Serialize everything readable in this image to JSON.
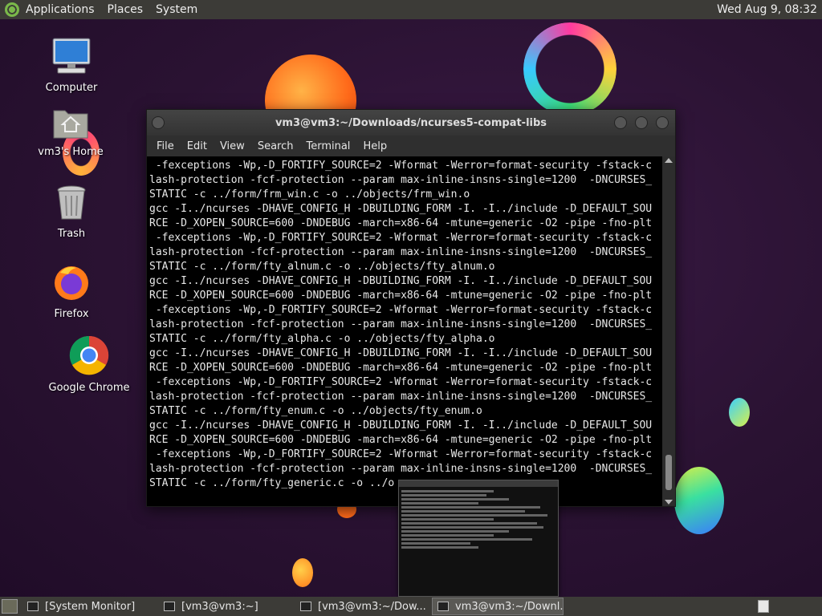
{
  "top_panel": {
    "menus": [
      "Applications",
      "Places",
      "System"
    ],
    "clock": "Wed Aug  9, 08:32"
  },
  "desktop_icons": {
    "computer": "Computer",
    "home": "vm3's Home",
    "trash": "Trash",
    "firefox": "Firefox",
    "chrome": "Google Chrome"
  },
  "terminal": {
    "title": "vm3@vm3:~/Downloads/ncurses5-compat-libs",
    "menus": [
      "File",
      "Edit",
      "View",
      "Search",
      "Terminal",
      "Help"
    ],
    "lines": [
      " -fexceptions -Wp,-D_FORTIFY_SOURCE=2 -Wformat -Werror=format-security -fstack-c",
      "lash-protection -fcf-protection --param max-inline-insns-single=1200  -DNCURSES_",
      "STATIC -c ../form/frm_win.c -o ../objects/frm_win.o",
      "gcc -I../ncurses -DHAVE_CONFIG_H -DBUILDING_FORM -I. -I../include -D_DEFAULT_SOU",
      "RCE -D_XOPEN_SOURCE=600 -DNDEBUG -march=x86-64 -mtune=generic -O2 -pipe -fno-plt",
      " -fexceptions -Wp,-D_FORTIFY_SOURCE=2 -Wformat -Werror=format-security -fstack-c",
      "lash-protection -fcf-protection --param max-inline-insns-single=1200  -DNCURSES_",
      "STATIC -c ../form/fty_alnum.c -o ../objects/fty_alnum.o",
      "gcc -I../ncurses -DHAVE_CONFIG_H -DBUILDING_FORM -I. -I../include -D_DEFAULT_SOU",
      "RCE -D_XOPEN_SOURCE=600 -DNDEBUG -march=x86-64 -mtune=generic -O2 -pipe -fno-plt",
      " -fexceptions -Wp,-D_FORTIFY_SOURCE=2 -Wformat -Werror=format-security -fstack-c",
      "lash-protection -fcf-protection --param max-inline-insns-single=1200  -DNCURSES_",
      "STATIC -c ../form/fty_alpha.c -o ../objects/fty_alpha.o",
      "gcc -I../ncurses -DHAVE_CONFIG_H -DBUILDING_FORM -I. -I../include -D_DEFAULT_SOU",
      "RCE -D_XOPEN_SOURCE=600 -DNDEBUG -march=x86-64 -mtune=generic -O2 -pipe -fno-plt",
      " -fexceptions -Wp,-D_FORTIFY_SOURCE=2 -Wformat -Werror=format-security -fstack-c",
      "lash-protection -fcf-protection --param max-inline-insns-single=1200  -DNCURSES_",
      "STATIC -c ../form/fty_enum.c -o ../objects/fty_enum.o",
      "gcc -I../ncurses -DHAVE_CONFIG_H -DBUILDING_FORM -I. -I../include -D_DEFAULT_SOU",
      "RCE -D_XOPEN_SOURCE=600 -DNDEBUG -march=x86-64 -mtune=generic -O2 -pipe -fno-plt",
      " -fexceptions -Wp,-D_FORTIFY_SOURCE=2 -Wformat -Werror=format-security -fstack-c",
      "lash-protection -fcf-protection --param max-inline-insns-single=1200  -DNCURSES_",
      "STATIC -c ../form/fty_generic.c -o ../o"
    ]
  },
  "taskbar": {
    "tasks": [
      {
        "label": "[System Monitor]",
        "active": false
      },
      {
        "label": "[vm3@vm3:~]",
        "active": false
      },
      {
        "label": "[vm3@vm3:~/Dow...",
        "active": false
      },
      {
        "label": "vm3@vm3:~/Downl...",
        "active": true
      }
    ]
  },
  "colors": {
    "panel_bg": "#3c3b37",
    "terminal_bg": "#000000",
    "terminal_fg": "#e8e8e8",
    "desktop_bg": "#2a1232"
  }
}
